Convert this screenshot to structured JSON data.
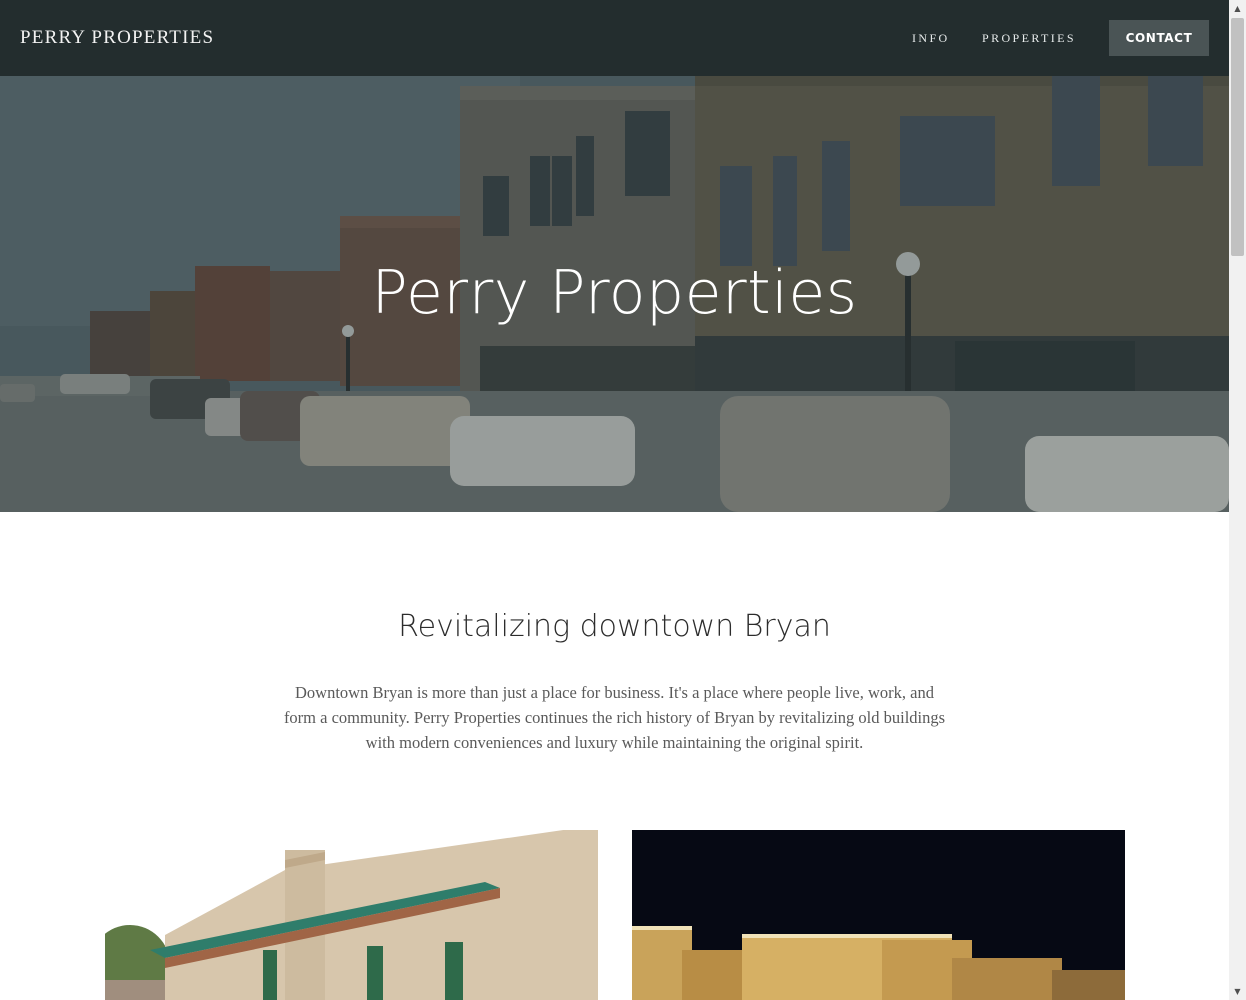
{
  "header": {
    "brand": "PERRY PROPERTIES",
    "nav": {
      "info": "INFO",
      "properties": "PROPERTIES",
      "contact": "CONTACT"
    }
  },
  "hero": {
    "title": "Perry Properties"
  },
  "intro": {
    "heading": "Revitalizing downtown Bryan",
    "body": "Downtown Bryan is more than just a place for business. It's a place where people live, work, and form a community. Perry Properties continues the rich history of Bryan by revitalizing old buildings with modern conveniences and luxury while maintaining the original spirit."
  },
  "colors": {
    "header_bg": "#232d2e",
    "contact_bg": "#4a5455",
    "heading_text": "#2c2c2c",
    "body_text": "#5a5a5a"
  },
  "icons": {
    "scroll_up": "chevron-up-icon",
    "scroll_down": "chevron-down-icon"
  }
}
